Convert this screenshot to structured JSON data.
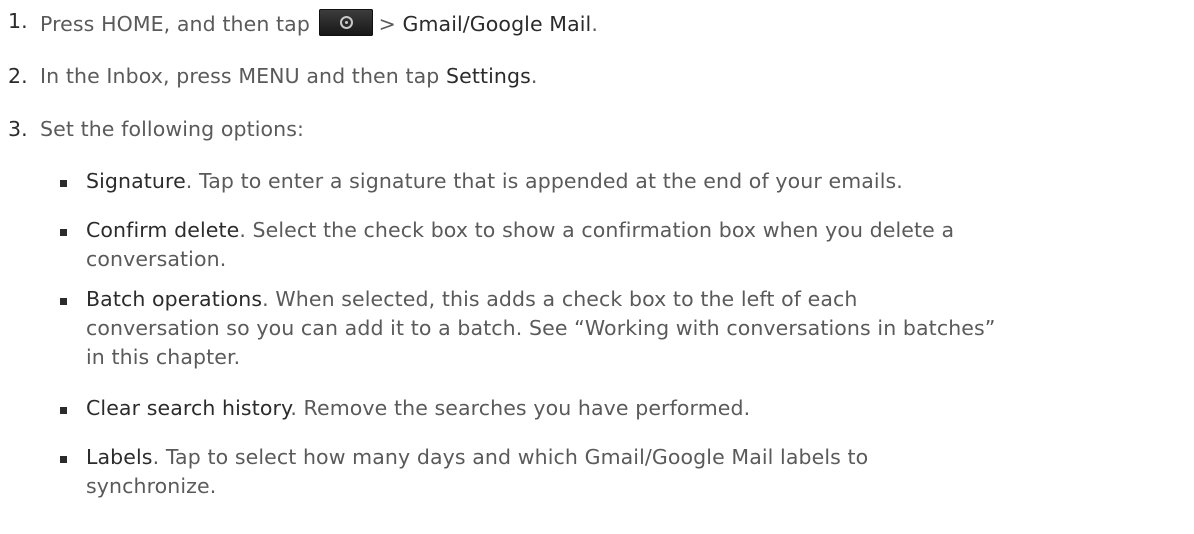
{
  "steps": [
    {
      "number": "1.",
      "prefix": "Press HOME, and then tap",
      "icon": "app-launcher-icon",
      "separator": ">",
      "target": "Gmail/Google Mail",
      "suffix": "."
    },
    {
      "number": "2.",
      "prefix": "In the Inbox, press MENU and then tap",
      "target": "Settings",
      "suffix": "."
    },
    {
      "number": "3.",
      "text": "Set the following options:"
    }
  ],
  "options": [
    {
      "term": "Signature",
      "line1": ". Tap to enter a signature that is appended at the end of your emails."
    },
    {
      "term": "Confirm delete",
      "line1": ". Select the check box to show a confirmation box when you delete a",
      "line2": "conversation."
    },
    {
      "term": "Batch operations",
      "line1": ". When selected, this adds a check box to the left of each",
      "line2": "conversation so you can add it to a batch. See “Working with conversations in batches”",
      "line3": "in this chapter."
    },
    {
      "term": "Clear search history",
      "line1": ". Remove the searches you have performed."
    },
    {
      "term": "Labels",
      "line1": ". Tap to select how many days and which Gmail/Google Mail labels to",
      "line2": "synchronize."
    }
  ]
}
